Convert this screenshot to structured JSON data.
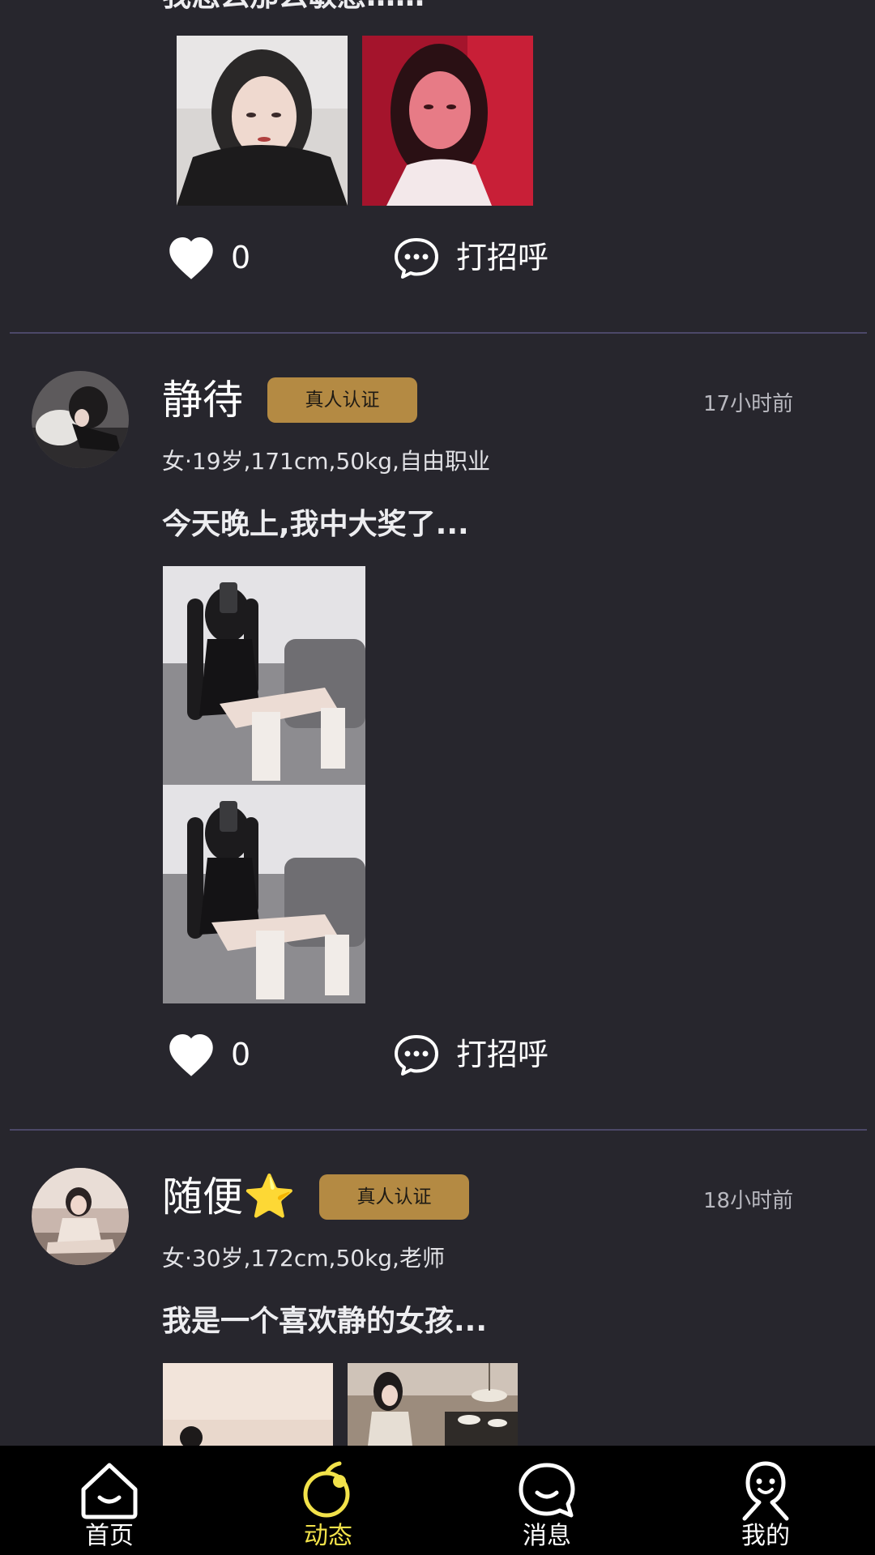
{
  "colors": {
    "background": "#27262d",
    "badge": "#b48a43",
    "divider": "#4c4868",
    "tab_active": "#f2e24a",
    "tab_inactive": "#ffffff",
    "tabbar": "#000000"
  },
  "posts": [
    {
      "partial_text": "我怎么那么敏感……",
      "likes": "0",
      "greet_label": "打招呼"
    },
    {
      "name": "静待",
      "badge": "真人认证",
      "time": "17小时前",
      "profile": "女·19岁,171cm,50kg,自由职业",
      "text": "今天晚上,我中大奖了...",
      "likes": "0",
      "greet_label": "打招呼"
    },
    {
      "name": "随便",
      "name_emoji": "⭐",
      "badge": "真人认证",
      "time": "18小时前",
      "profile": "女·30岁,172cm,50kg,老师",
      "text": "我是一个喜欢静的女孩..."
    }
  ],
  "tabs": [
    {
      "label": "首页",
      "icon": "home-icon",
      "active": false
    },
    {
      "label": "动态",
      "icon": "feed-icon",
      "active": true
    },
    {
      "label": "消息",
      "icon": "message-icon",
      "active": false
    },
    {
      "label": "我的",
      "icon": "profile-icon",
      "active": false
    }
  ]
}
